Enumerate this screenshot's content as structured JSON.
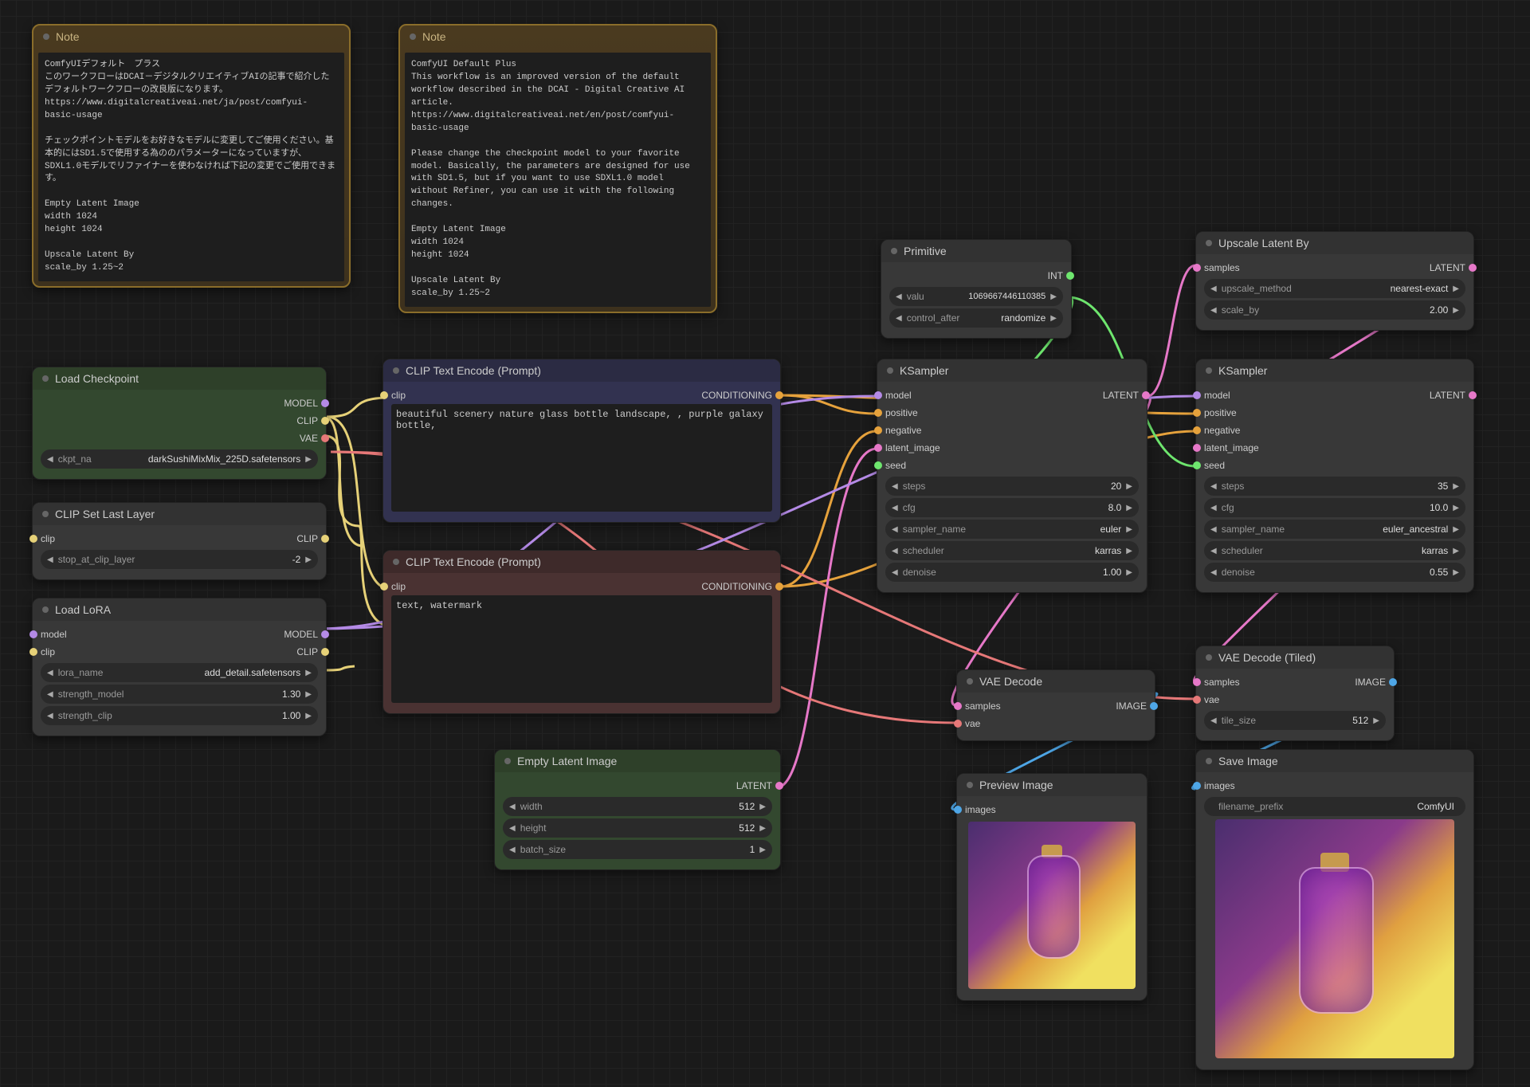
{
  "notes": {
    "jp": {
      "title": "Note",
      "body": "ComfyUIデフォルト　プラス\nこのワークフローはDCAI－デジタルクリエイティブAIの記事で紹介したデフォルトワークフローの改良版になります。\nhttps://www.digitalcreativeai.net/ja/post/comfyui-basic-usage\n\nチェックポイントモデルをお好きなモデルに変更してご使用ください。基本的にはSD1.5で使用する為ののパラメーターになっていますが、SDXL1.0モデルでリファイナーを使わなければ下記の変更でご使用できます。\n\nEmpty Latent Image\nwidth 1024\nheight 1024\n\nUpscale Latent By\nscale_by 1.25~2"
    },
    "en": {
      "title": "Note",
      "body": "ComfyUI Default Plus\nThis workflow is an improved version of the default workflow described in the DCAI - Digital Creative AI article.\nhttps://www.digitalcreativeai.net/en/post/comfyui-basic-usage\n\nPlease change the checkpoint model to your favorite model. Basically, the parameters are designed for use with SD1.5, but if you want to use SDXL1.0 model without Refiner, you can use it with the following changes.\n\nEmpty Latent Image\nwidth 1024\nheight 1024\n\nUpscale Latent By\nscale_by 1.25~2"
    }
  },
  "load_checkpoint": {
    "title": "Load Checkpoint",
    "out_model": "MODEL",
    "out_clip": "CLIP",
    "out_vae": "VAE",
    "ckpt_label": "ckpt_na",
    "ckpt_value": "darkSushiMixMix_225D.safetensors"
  },
  "clip_set": {
    "title": "CLIP Set Last Layer",
    "in_clip": "clip",
    "out_clip": "CLIP",
    "stop_label": "stop_at_clip_layer",
    "stop_value": "-2"
  },
  "load_lora": {
    "title": "Load LoRA",
    "in_model": "model",
    "in_clip": "clip",
    "out_model": "MODEL",
    "out_clip": "CLIP",
    "lora_name_label": "lora_name",
    "lora_name_value": "add_detail.safetensors",
    "strength_model_label": "strength_model",
    "strength_model_value": "1.30",
    "strength_clip_label": "strength_clip",
    "strength_clip_value": "1.00"
  },
  "clip_pos": {
    "title": "CLIP Text Encode (Prompt)",
    "in_clip": "clip",
    "out_cond": "CONDITIONING",
    "text": "beautiful scenery nature glass bottle landscape, , purple galaxy bottle,"
  },
  "clip_neg": {
    "title": "CLIP Text Encode (Prompt)",
    "in_clip": "clip",
    "out_cond": "CONDITIONING",
    "text": "text, watermark"
  },
  "empty_latent": {
    "title": "Empty Latent Image",
    "out_latent": "LATENT",
    "width_label": "width",
    "width_value": "512",
    "height_label": "height",
    "height_value": "512",
    "batch_label": "batch_size",
    "batch_value": "1"
  },
  "primitive": {
    "title": "Primitive",
    "out": "INT",
    "value_label": "valu",
    "value": "1069667446110385",
    "control_label": "control_after",
    "control_value": "randomize"
  },
  "ksampler1": {
    "title": "KSampler",
    "in_model": "model",
    "in_positive": "positive",
    "in_negative": "negative",
    "in_latent": "latent_image",
    "in_seed": "seed",
    "out_latent": "LATENT",
    "steps_label": "steps",
    "steps_value": "20",
    "cfg_label": "cfg",
    "cfg_value": "8.0",
    "sampler_label": "sampler_name",
    "sampler_value": "euler",
    "scheduler_label": "scheduler",
    "scheduler_value": "karras",
    "denoise_label": "denoise",
    "denoise_value": "1.00"
  },
  "upscale": {
    "title": "Upscale Latent By",
    "in_samples": "samples",
    "out_latent": "LATENT",
    "method_label": "upscale_method",
    "method_value": "nearest-exact",
    "scale_label": "scale_by",
    "scale_value": "2.00"
  },
  "ksampler2": {
    "title": "KSampler",
    "in_model": "model",
    "in_positive": "positive",
    "in_negative": "negative",
    "in_latent": "latent_image",
    "in_seed": "seed",
    "out_latent": "LATENT",
    "steps_label": "steps",
    "steps_value": "35",
    "cfg_label": "cfg",
    "cfg_value": "10.0",
    "sampler_label": "sampler_name",
    "sampler_value": "euler_ancestral",
    "scheduler_label": "scheduler",
    "scheduler_value": "karras",
    "denoise_label": "denoise",
    "denoise_value": "0.55"
  },
  "vae_decode": {
    "title": "VAE Decode",
    "in_samples": "samples",
    "in_vae": "vae",
    "out_image": "IMAGE"
  },
  "vae_decode_tiled": {
    "title": "VAE Decode (Tiled)",
    "in_samples": "samples",
    "in_vae": "vae",
    "out_image": "IMAGE",
    "tile_label": "tile_size",
    "tile_value": "512"
  },
  "preview": {
    "title": "Preview Image",
    "in_images": "images"
  },
  "save": {
    "title": "Save Image",
    "in_images": "images",
    "prefix_label": "filename_prefix",
    "prefix_value": "ComfyUI"
  },
  "port_colors": {
    "model": "#b48ae6",
    "clip": "#e6d178",
    "vae": "#e67878",
    "conditioning": "#e6a23c",
    "latent": "#e678c8",
    "image": "#4ea6e6",
    "int": "#6ee66e"
  }
}
